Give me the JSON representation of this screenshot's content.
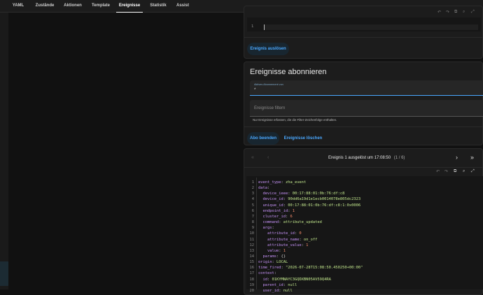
{
  "tabs": [
    "YAML",
    "Zustände",
    "Aktionen",
    "Template",
    "Ereignisse",
    "Statistik",
    "Assist"
  ],
  "active_tab": "Ereignisse",
  "fire_event": {
    "line_number": "1",
    "button_label": "Ereignis auslösen"
  },
  "subscribe": {
    "title": "Ereignisse abonnieren",
    "active_subscription_label": "Aktives Abonnement von",
    "active_subscription_value": "*",
    "filter_placeholder": "Ereignisse filtern",
    "filter_hint": "Nur Ereignisse erfassen, die die Filter-Zeichenfolge enthalten.",
    "stop_label": "Abo beenden",
    "clear_label": "Ereignisse löschen"
  },
  "event_view": {
    "header": "Ereignis 1 ausgelöst um 17:08:50",
    "counter": "(1 / 6)"
  },
  "code_lines": [
    {
      "n": "1",
      "text": "event_type: zha_event"
    },
    {
      "n": "2",
      "text": "data:"
    },
    {
      "n": "3",
      "text": "  device_ieee: 00:17:88:01:0b:76:df:c8"
    },
    {
      "n": "4",
      "text": "  device_id: 90dd6a19d1e1ecb0014078e805dc2323"
    },
    {
      "n": "5",
      "text": "  unique_id: 00:17:88:01:0b:76:df:c8:1:0x0006"
    },
    {
      "n": "6",
      "text": "  endpoint_id: 1"
    },
    {
      "n": "7",
      "text": "  cluster_id: 6"
    },
    {
      "n": "8",
      "text": "  command: attribute_updated"
    },
    {
      "n": "9",
      "text": "  args:"
    },
    {
      "n": "10",
      "text": "    attribute_id: 0"
    },
    {
      "n": "11",
      "text": "    attribute_name: on_off"
    },
    {
      "n": "12",
      "text": "    attribute_value: 1"
    },
    {
      "n": "13",
      "text": "    value: 1"
    },
    {
      "n": "14",
      "text": "  params: {}"
    },
    {
      "n": "15",
      "text": "origin: LOCAL"
    },
    {
      "n": "16",
      "text": "time_fired: \"2026-07-28T15:08:50.450250+00:00\""
    },
    {
      "n": "17",
      "text": "context:"
    },
    {
      "n": "18",
      "text": "  id: 01KYMNAYC3GQDXBN05AV59Q4RA"
    },
    {
      "n": "19",
      "text": "  parent_id: null"
    },
    {
      "n": "20",
      "text": "  user_id: null"
    }
  ],
  "colors": {
    "accent": "#4aa8ff",
    "key": "#c692f7",
    "string": "#c3e88d",
    "number": "#f78c6c"
  }
}
